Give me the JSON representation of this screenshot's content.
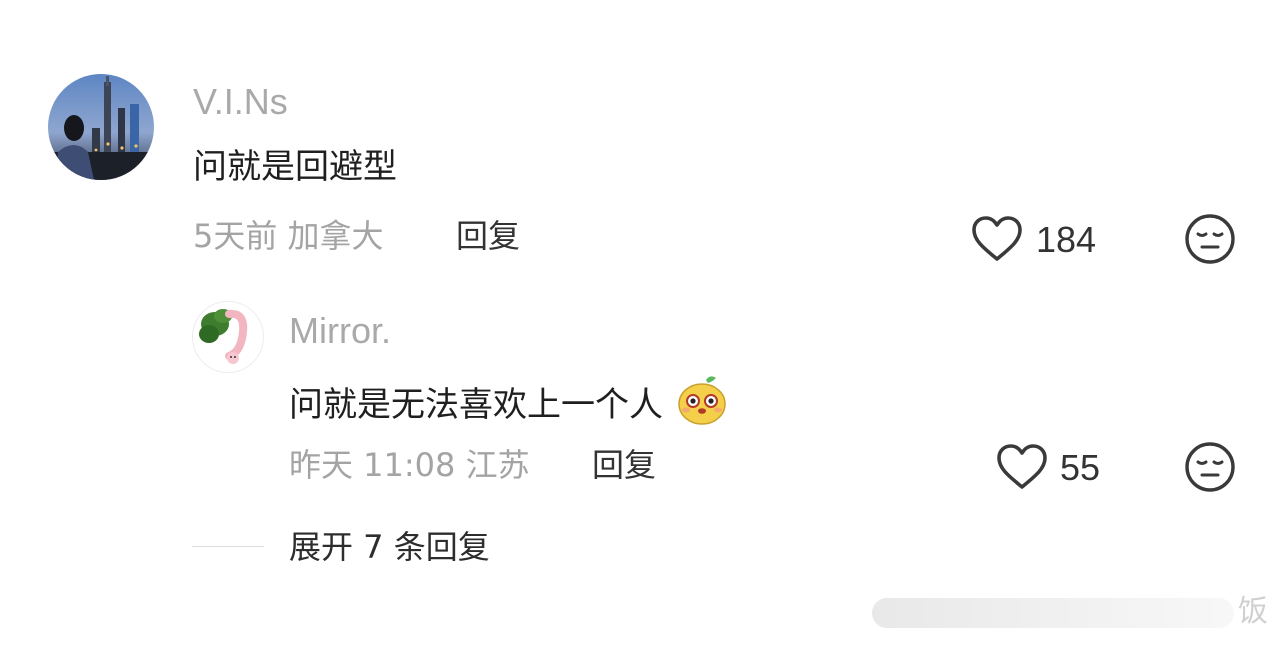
{
  "comment": {
    "username": "V.I.Ns",
    "text": "问就是回避型",
    "time_location": "5天前 加拿大",
    "reply_label": "回复",
    "likes": "184"
  },
  "reply": {
    "username": "Mirror.",
    "text": "问就是无法喜欢上一个人",
    "emoji_icon": "sticker-emoji-icon",
    "time_location": "昨天 11:08 江苏",
    "reply_label": "回复",
    "likes": "55"
  },
  "expand_label": "展开 7 条回复",
  "watermark": "饭",
  "colors": {
    "username": "#a9a9a9",
    "meta": "#a4a4a4",
    "icon_stroke": "#3a3a3a"
  }
}
